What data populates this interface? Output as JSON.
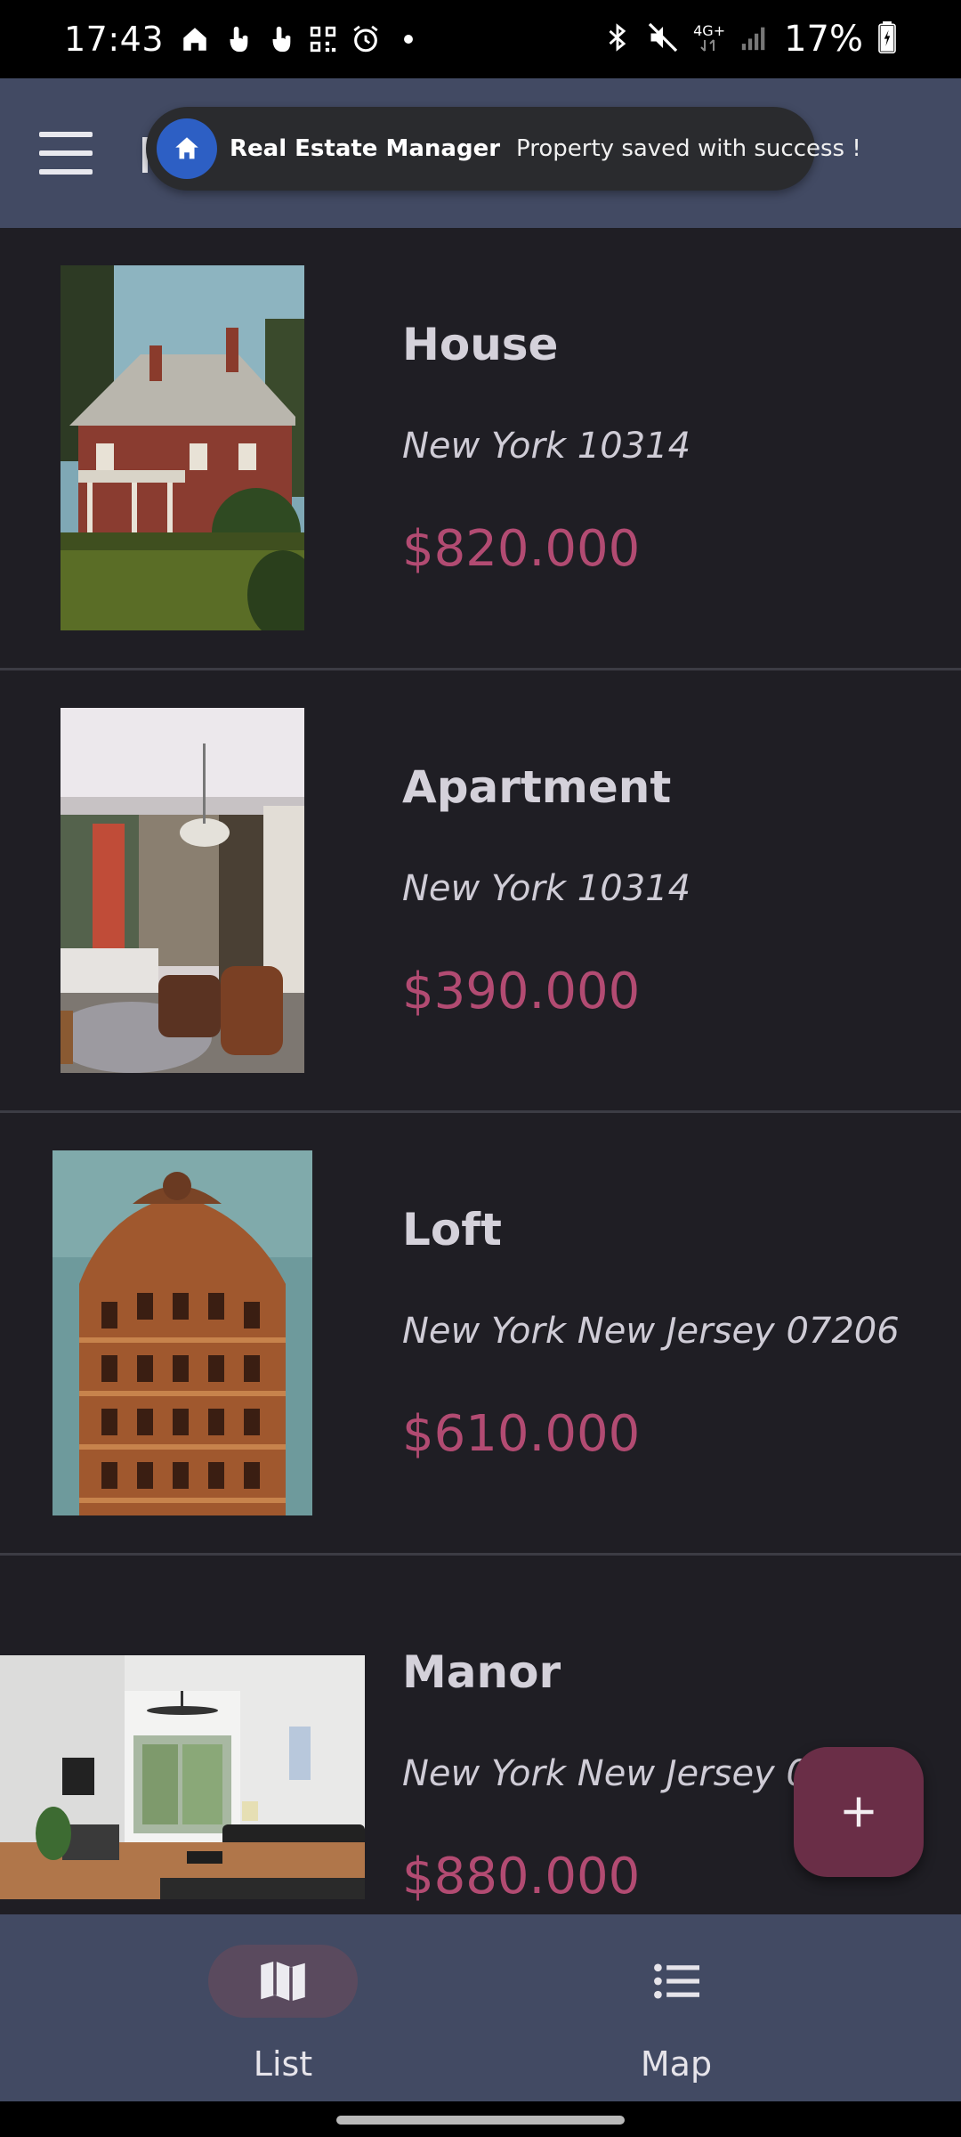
{
  "status_bar": {
    "time": "17:43",
    "left_icons": [
      "home-icon",
      "touch-icon",
      "touch-icon",
      "qr-code-icon",
      "alarm-icon",
      "dot-icon"
    ],
    "right_icons": [
      "bluetooth-icon",
      "mute-icon",
      "network-4g-icon",
      "signal-icon"
    ],
    "network_label": "4G+",
    "battery": "17%"
  },
  "app_bar": {
    "menu_icon": "menu-icon"
  },
  "toast": {
    "app_name": "Real Estate Manager",
    "message": "Property saved with success !",
    "icon": "home-icon",
    "icon_color": "#2d5fc4"
  },
  "properties": [
    {
      "type": "House",
      "address": "New York 10314",
      "price": "$820.000",
      "image": "house-photo"
    },
    {
      "type": "Apartment",
      "address": "New York 10314",
      "price": "$390.000",
      "image": "apartment-interior-photo"
    },
    {
      "type": "Loft",
      "address": "New York New Jersey 07206",
      "price": "$610.000",
      "image": "building-facade-photo"
    },
    {
      "type": "Manor",
      "address": "New York New Jersey 07206",
      "price": "$880.000",
      "image": "living-room-photo"
    }
  ],
  "fab": {
    "icon": "plus-icon"
  },
  "bottom_nav": {
    "items": [
      {
        "label": "List",
        "icon": "map-icon",
        "selected": true
      },
      {
        "label": "Map",
        "icon": "list-icon",
        "selected": false
      }
    ]
  },
  "colors": {
    "app_bar": "#424a63",
    "background": "#1f1e24",
    "price": "#b24b72",
    "fab": "#6a2e47",
    "nav_pill": "#5a4a5e"
  }
}
